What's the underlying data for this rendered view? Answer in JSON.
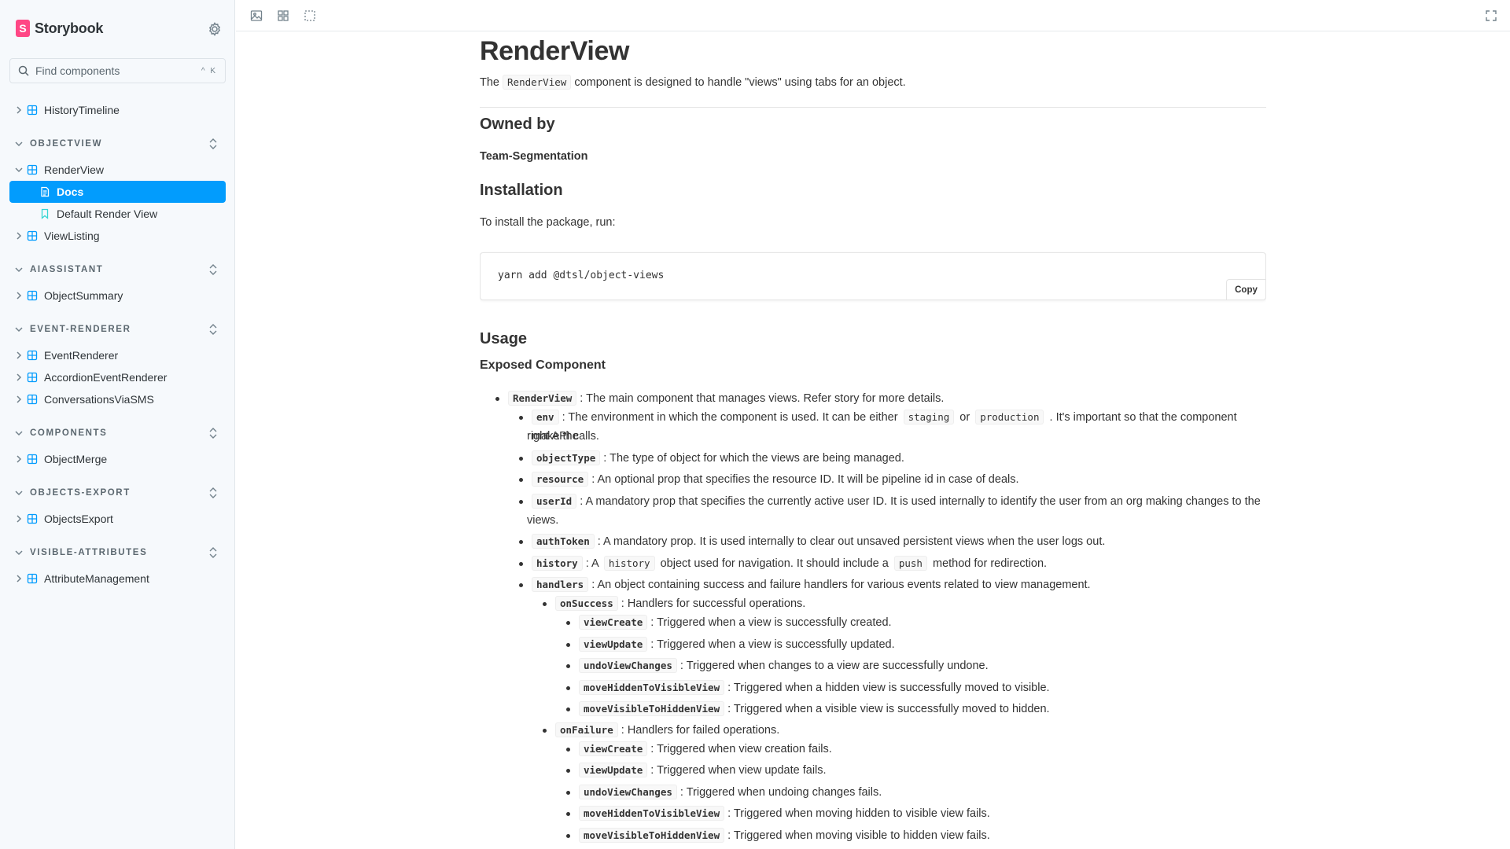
{
  "app": {
    "name": "Storybook",
    "brand_color": "#ff4785",
    "accent_color": "#029cfd"
  },
  "sidebar": {
    "search_placeholder": "Find components",
    "search_shortcut": "^ K",
    "top_items": [
      {
        "label": "HistoryTimeline"
      }
    ],
    "groups": [
      {
        "title": "OBJECTVIEW",
        "items": [
          "RenderView",
          "Docs",
          "Default Render View",
          "ViewListing"
        ]
      },
      {
        "title": "AIASSISTANT",
        "items": [
          "ObjectSummary"
        ]
      },
      {
        "title": "EVENT-RENDERER",
        "items": [
          "EventRenderer",
          "AccordionEventRenderer",
          "ConversationsViaSMS"
        ]
      },
      {
        "title": "COMPONENTS",
        "items": [
          "ObjectMerge"
        ]
      },
      {
        "title": "OBJECTS-EXPORT",
        "items": [
          "ObjectsExport"
        ]
      },
      {
        "title": "VISIBLE-ATTRIBUTES",
        "items": [
          "AttributeManagement"
        ]
      }
    ],
    "active_item": "Docs"
  },
  "doc": {
    "title": "RenderView",
    "lead_prefix": "The",
    "lead_code": "RenderView",
    "lead_suffix": "component is designed to handle \"views\" using tabs for an object.",
    "owned_heading": "Owned by",
    "owner": "Team-Segmentation",
    "install_heading": "Installation",
    "install_text": "To install the package, run:",
    "install_cmd": "yarn add @dtsl/object-views",
    "copy_label": "Copy",
    "usage_heading": "Usage",
    "exposed_heading": "Exposed Component",
    "props": {
      "renderview": {
        "key": "RenderView",
        "text": ": The main component that manages views. Refer story for more details."
      },
      "env": {
        "key": "env",
        "t1": ": The environment in which the component is used. It can be either",
        "c1": "staging",
        "t2": "or",
        "c2": "production",
        "t3": ". It's important so that the component make the",
        "t4": "right API calls."
      },
      "objectType": {
        "key": "objectType",
        "text": ": The type of object for which the views are being managed."
      },
      "resource": {
        "key": "resource",
        "text": ": An optional prop that specifies the resource ID. It will be pipeline id in case of deals."
      },
      "userId": {
        "key": "userId",
        "t1": ": A mandatory prop that specifies the currently active user ID. It is used internally to identify the user from an org making changes to the",
        "t2": "views."
      },
      "authToken": {
        "key": "authToken",
        "text": ": A mandatory prop. It is used internally to clear out unsaved persistent views when the user logs out."
      },
      "history": {
        "key": "history",
        "t1": ": A",
        "c1": "history",
        "t2": "object used for navigation. It should include a",
        "c2": "push",
        "t3": "method for redirection."
      },
      "handlers": {
        "key": "handlers",
        "text": ": An object containing success and failure handlers for various events related to view management."
      },
      "onSuccess": {
        "key": "onSuccess",
        "text": ": Handlers for successful operations."
      },
      "s_viewCreate": {
        "key": "viewCreate",
        "text": ": Triggered when a view is successfully created."
      },
      "s_viewUpdate": {
        "key": "viewUpdate",
        "text": ": Triggered when a view is successfully updated."
      },
      "s_undo": {
        "key": "undoViewChanges",
        "text": ": Triggered when changes to a view are successfully undone."
      },
      "s_h2v": {
        "key": "moveHiddenToVisibleView",
        "text": ": Triggered when a hidden view is successfully moved to visible."
      },
      "s_v2h": {
        "key": "moveVisibleToHiddenView",
        "text": ": Triggered when a visible view is successfully moved to hidden."
      },
      "onFailure": {
        "key": "onFailure",
        "text": ": Handlers for failed operations."
      },
      "f_viewCreate": {
        "key": "viewCreate",
        "text": ": Triggered when view creation fails."
      },
      "f_viewUpdate": {
        "key": "viewUpdate",
        "text": ": Triggered when view update fails."
      },
      "f_undo": {
        "key": "undoViewChanges",
        "text": ": Triggered when undoing changes fails."
      },
      "f_h2v": {
        "key": "moveHiddenToVisibleView",
        "text": ": Triggered when moving hidden to visible view fails."
      },
      "f_v2h": {
        "key": "moveVisibleToHiddenView",
        "text": ": Triggered when moving visible to hidden view fails."
      }
    }
  }
}
